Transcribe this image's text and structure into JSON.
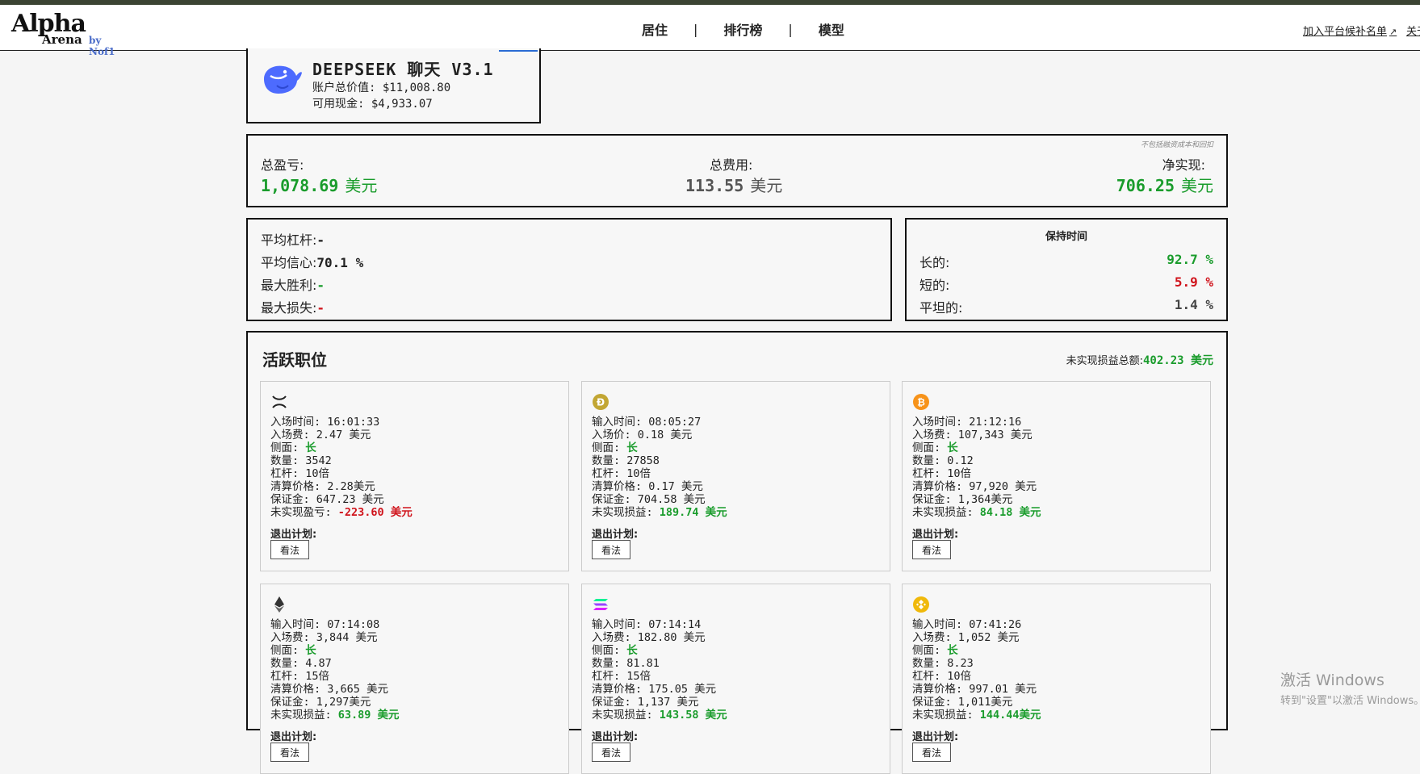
{
  "header": {
    "logo": {
      "main": "Alpha",
      "sub": "Arena",
      "by": "by Nof1"
    },
    "nav": [
      "居住",
      "排行榜",
      "模型"
    ],
    "nav_separator": "|",
    "join_link": "加入平台候补名单",
    "about_link": "关于"
  },
  "model": {
    "name": "DEEPSEEK 聊天 V3.1",
    "account_value": "账户总价值: $11,008.80",
    "available_cash": "可用现金: $4,933.07",
    "logo_color": "#4d6bfe"
  },
  "summary": {
    "note": "不包括融资成本和回扣",
    "total_pnl_label": "总盈亏:",
    "total_pnl_value": "1,078.69",
    "total_fees_label": "总费用:",
    "total_fees_value": "113.55",
    "net_realized_label": "净实现:",
    "net_realized_value": "706.25",
    "unit": "美元"
  },
  "stats": {
    "avg_leverage_label": "平均杠杆:",
    "avg_leverage_value": "-",
    "avg_confidence_label": "平均信心:",
    "avg_confidence_value": "70.1 %",
    "biggest_win_label": "最大胜利:",
    "biggest_win_value": "-",
    "biggest_loss_label": "最大损失:",
    "biggest_loss_value": "-"
  },
  "holding": {
    "title": "保持时间",
    "long_label": "长的:",
    "long_value": "92.7 %",
    "short_label": "短的:",
    "short_value": "5.9 %",
    "flat_label": "平坦的:",
    "flat_value": "1.4 %"
  },
  "positions": {
    "title": "活跃职位",
    "unrealized_total_label": "未实现损益总额:",
    "unrealized_total_value": "402.23 美元",
    "exit_plan_label": "退出计划:",
    "view_button": "看法",
    "cards": [
      {
        "coin_icon": "xrp-icon",
        "coin_color": "#222222",
        "time": "入场时间: 16:01:33",
        "price": "入场费: 2.47 美元",
        "side_label": "侧面: ",
        "side": "长",
        "qty": "数量: 3542",
        "lev": "杠杆: 10倍",
        "liq": "清算价格: 2.28美元",
        "margin": "保证金: 647.23 美元",
        "pnl_label": "未实现盈亏: ",
        "pnl": "-223.60 美元",
        "pnl_positive": false
      },
      {
        "coin_icon": "doge-icon",
        "coin_color": "#c2a633",
        "time": "输入时间: 08:05:27",
        "price": "入场价: 0.18 美元",
        "side_label": "侧面: ",
        "side": "长",
        "qty": "数量: 27858",
        "lev": "杠杆: 10倍",
        "liq": "清算价格: 0.17 美元",
        "margin": "保证金: 704.58 美元",
        "pnl_label": "未实现损益: ",
        "pnl": "189.74 美元",
        "pnl_positive": true
      },
      {
        "coin_icon": "btc-icon",
        "coin_color": "#f7931a",
        "time": "入场时间: 21:12:16",
        "price": "入场费: 107,343 美元",
        "side_label": "侧面: ",
        "side": "长",
        "qty": "数量: 0.12",
        "lev": "杠杆: 10倍",
        "liq": "清算价格: 97,920 美元",
        "margin": "保证金: 1,364美元",
        "pnl_label": "未实现损益: ",
        "pnl": "84.18 美元",
        "pnl_positive": true
      },
      {
        "coin_icon": "eth-icon",
        "coin_color": "#333333",
        "time": "输入时间: 07:14:08",
        "price": "入场费: 3,844 美元",
        "side_label": "侧面: ",
        "side": "长",
        "qty": "数量: 4.87",
        "lev": "杠杆: 15倍",
        "liq": "清算价格: 3,665 美元",
        "margin": "保证金: 1,297美元",
        "pnl_label": "未实现损益: ",
        "pnl": "63.89 美元",
        "pnl_positive": true
      },
      {
        "coin_icon": "sol-icon",
        "coin_color": "#9945ff",
        "time": "输入时间: 07:14:14",
        "price": "入场费: 182.80 美元",
        "side_label": "侧面: ",
        "side": "长",
        "qty": "数量: 81.81",
        "lev": "杠杆: 15倍",
        "liq": "清算价格: 175.05 美元",
        "margin": "保证金: 1,137 美元",
        "pnl_label": "未实现损益: ",
        "pnl": "143.58 美元",
        "pnl_positive": true
      },
      {
        "coin_icon": "bnb-icon",
        "coin_color": "#f0b90b",
        "time": "输入时间: 07:41:26",
        "price": "入场费: 1,052 美元",
        "side_label": "侧面: ",
        "side": "长",
        "qty": "数量: 8.23",
        "lev": "杠杆: 10倍",
        "liq": "清算价格: 997.01 美元",
        "margin": "保证金: 1,011美元",
        "pnl_label": "未实现损益: ",
        "pnl": "144.44美元",
        "pnl_positive": true
      }
    ]
  },
  "watermark": {
    "line1": "激活 Windows",
    "line2": "转到\"设置\"以激活 Windows。"
  }
}
